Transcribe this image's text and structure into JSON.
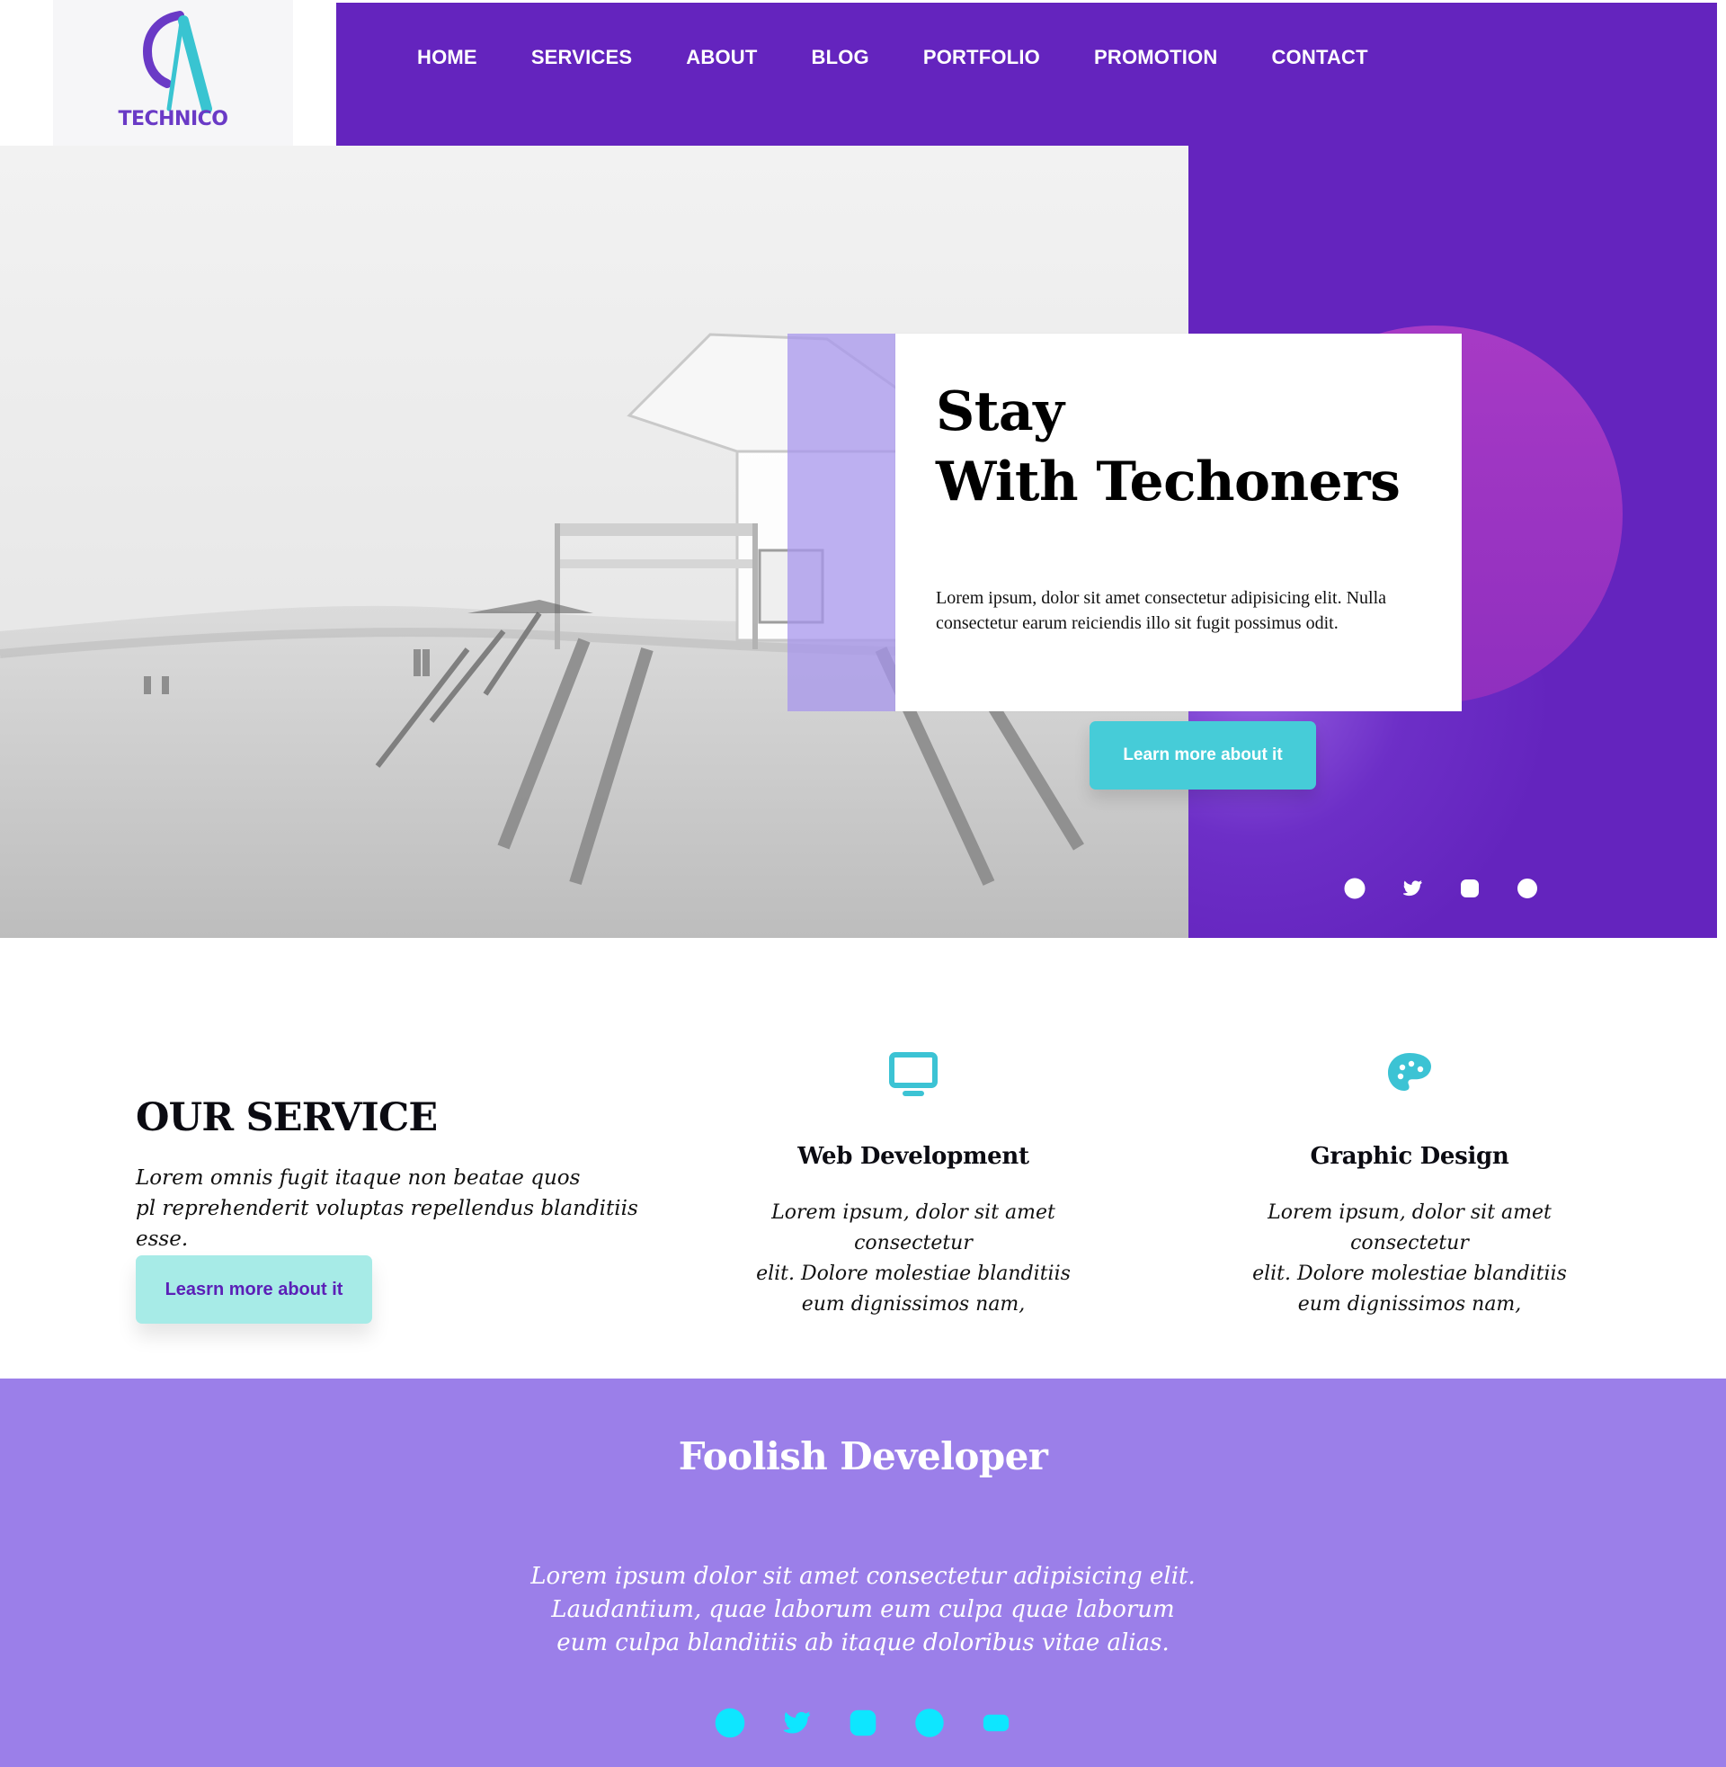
{
  "brand": {
    "logo_text": "TECHNICO",
    "colors": {
      "primary_purple": "#6424be",
      "lavender": "#9b7fe9",
      "teal": "#46ccd8",
      "teal_light": "#a7ebe7",
      "pink": "#a33ac1"
    }
  },
  "nav": {
    "items": [
      {
        "label": "HOME"
      },
      {
        "label": "SERVICES"
      },
      {
        "label": "ABOUT"
      },
      {
        "label": "BLOG"
      },
      {
        "label": "PORTFOLIO"
      },
      {
        "label": "PROMOTION"
      },
      {
        "label": "CONTACT"
      }
    ]
  },
  "hero": {
    "title_line1": "Stay",
    "title_line2": "With Techoners",
    "body": "Lorem ipsum, dolor sit amet consectetur adipisicing elit. Nulla consectetur earum reiciendis illo sit fugit possimus odit.",
    "cta": "Learn more about it",
    "social_icons": [
      "facebook-icon",
      "twitter-icon",
      "instagram-icon",
      "globe-icon"
    ]
  },
  "services": {
    "title": "OUR SERVICE",
    "description": "Lorem omnis fugit itaque non beatae quos\npl reprehenderit voluptas repellendus blanditiis esse.",
    "cta": "Leasrn more about it",
    "items": [
      {
        "icon": "monitor-icon",
        "title": "Web Development",
        "text": "Lorem ipsum, dolor sit amet consectetur\nelit. Dolore molestiae blanditiis\neum dignissimos nam,"
      },
      {
        "icon": "palette-icon",
        "title": "Graphic Design",
        "text": "Lorem ipsum, dolor sit amet consectetur\nelit. Dolore molestiae blanditiis\neum dignissimos nam,"
      }
    ]
  },
  "footer": {
    "title": "Foolish Developer",
    "text": "Lorem ipsum dolor sit amet consectetur adipisicing elit.\nLaudantium, quae laborum eum culpa quae laborum\neum culpa blanditiis ab itaque doloribus vitae alias.",
    "social_icons": [
      "facebook-icon",
      "twitter-icon",
      "instagram-icon",
      "globe-icon",
      "youtube-icon"
    ]
  }
}
